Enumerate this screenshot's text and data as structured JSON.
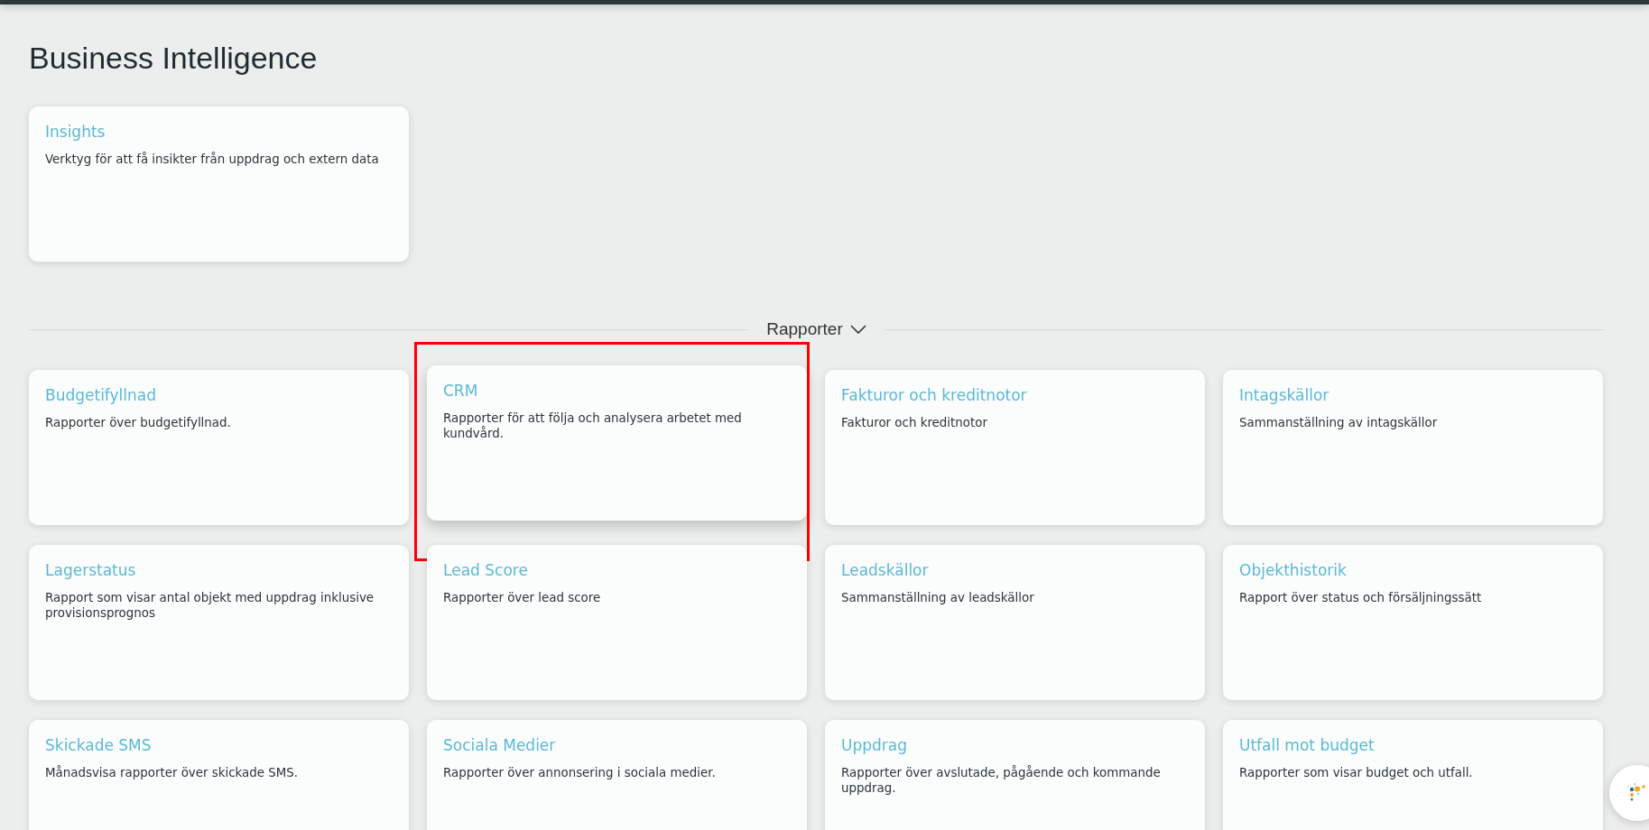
{
  "page": {
    "title": "Business Intelligence"
  },
  "featured": [
    {
      "title": "Insights",
      "description": "Verktyg för att få insikter från uppdrag och extern data"
    }
  ],
  "section": {
    "label": "Rapporter",
    "expanded": true
  },
  "reports": [
    {
      "title": "Budgetifyllnad",
      "description": "Rapporter över budgetifyllnad.",
      "highlighted": false
    },
    {
      "title": "CRM",
      "description": "Rapporter för att följa och analysera arbetet med kundvård.",
      "highlighted": true
    },
    {
      "title": "Fakturor och kreditnotor",
      "description": "Fakturor och kreditnotor",
      "highlighted": false
    },
    {
      "title": "Intagskällor",
      "description": "Sammanställning av intagskällor",
      "highlighted": false
    },
    {
      "title": "Lagerstatus",
      "description": "Rapport som visar antal objekt med uppdrag inklusive provisionsprognos",
      "highlighted": false
    },
    {
      "title": "Lead Score",
      "description": "Rapporter över lead score",
      "highlighted": false
    },
    {
      "title": "Leadskällor",
      "description": "Sammanställning av leadskällor",
      "highlighted": false
    },
    {
      "title": "Objekthistorik",
      "description": "Rapport över status och försäljningssätt",
      "highlighted": false
    },
    {
      "title": "Skickade SMS",
      "description": "Månadsvisa rapporter över skickade SMS.",
      "highlighted": false
    },
    {
      "title": "Sociala Medier",
      "description": "Rapporter över annonsering i sociala medier.",
      "highlighted": false
    },
    {
      "title": "Uppdrag",
      "description": "Rapporter över avslutade, pågående och kommande uppdrag.",
      "highlighted": false
    },
    {
      "title": "Utfall mot budget",
      "description": "Rapporter som visar budget och utfall.",
      "highlighted": false
    }
  ]
}
